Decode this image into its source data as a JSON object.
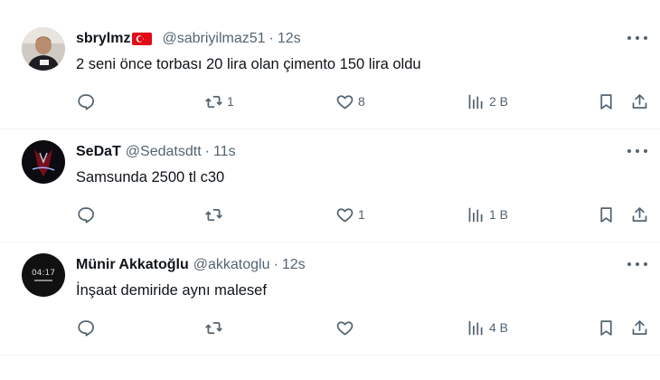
{
  "tweets": [
    {
      "name": "sbrylmz",
      "handle": "@sabriyilmaz51",
      "separator": "·",
      "time": "12s",
      "text": "2 seni önce torbası 20  lira olan çimento  150 lira oldu",
      "retweets": "1",
      "likes": "8",
      "views": "2 B",
      "flag": "turkey-flag-emoji"
    },
    {
      "name": "SeDaT",
      "handle": "@Sedatsdtt",
      "separator": "·",
      "time": "11s",
      "text": "Samsunda 2500 tl c30",
      "retweets": "",
      "likes": "1",
      "views": "1 B"
    },
    {
      "name": "Münir Akkatoğlu",
      "handle": "@akkatoglu",
      "separator": "·",
      "time": "12s",
      "text": "İnşaat demiride aynı malesef",
      "retweets": "",
      "likes": "",
      "views": "4 B",
      "avatar_text": "04:17"
    }
  ],
  "icons": {
    "reply": "reply-icon",
    "retweet": "retweet-icon",
    "like": "heart-icon",
    "views": "views-chart-icon",
    "bookmark": "bookmark-icon",
    "share": "share-icon",
    "more": "more-dots-icon"
  },
  "colors": {
    "text": "#0f1419",
    "muted": "#536471",
    "divider": "#eff3f4"
  }
}
